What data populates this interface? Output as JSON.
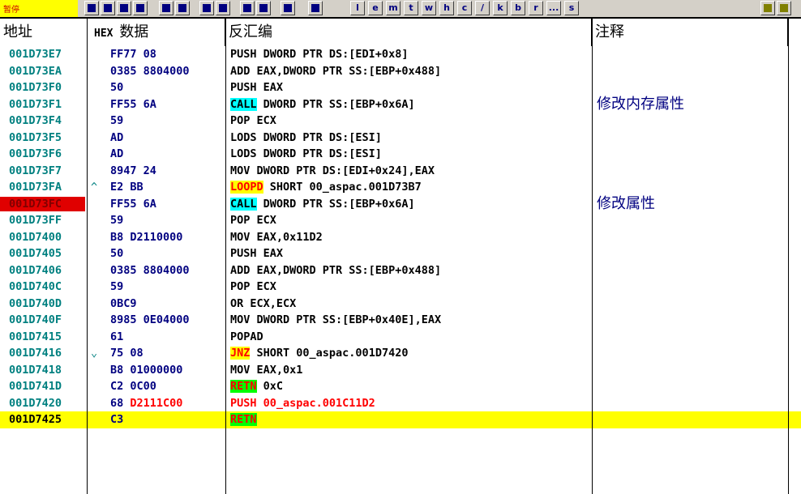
{
  "toolbar": {
    "status_text": "暂停",
    "buttons": [
      "l",
      "e",
      "m",
      "t",
      "w",
      "h",
      "c",
      "/",
      "k",
      "b",
      "r",
      "...",
      "s"
    ]
  },
  "columns": {
    "address": "地址",
    "hex_prefix": "HEX",
    "hex_cn": "数据",
    "disasm": "反汇编",
    "comment": "注释"
  },
  "rows": [
    {
      "addr": "001D73E7",
      "mark": "",
      "hex": "FF77 08",
      "asm": [
        {
          "t": "PUSH DWORD PTR DS:[EDI+0x8]"
        }
      ],
      "comment": ""
    },
    {
      "addr": "001D73EA",
      "mark": "",
      "hex": "0385 8804000",
      "asm": [
        {
          "t": "ADD EAX,DWORD PTR SS:[EBP+0x488]"
        }
      ],
      "comment": ""
    },
    {
      "addr": "001D73F0",
      "mark": "",
      "hex": "50",
      "asm": [
        {
          "t": "PUSH EAX"
        }
      ],
      "comment": ""
    },
    {
      "addr": "001D73F1",
      "mark": "",
      "hex": "FF55 6A",
      "asm": [
        {
          "t": "CALL",
          "cls": "hl-call"
        },
        {
          "t": " DWORD PTR SS:[EBP+0x6A]"
        }
      ],
      "comment": "修改内存属性"
    },
    {
      "addr": "001D73F4",
      "mark": "",
      "hex": "59",
      "asm": [
        {
          "t": "POP ECX"
        }
      ],
      "comment": ""
    },
    {
      "addr": "001D73F5",
      "mark": "",
      "hex": "AD",
      "asm": [
        {
          "t": "LODS DWORD PTR DS:[ESI]"
        }
      ],
      "comment": ""
    },
    {
      "addr": "001D73F6",
      "mark": "",
      "hex": "AD",
      "asm": [
        {
          "t": "LODS DWORD PTR DS:[ESI]"
        }
      ],
      "comment": ""
    },
    {
      "addr": "001D73F7",
      "mark": "",
      "hex": "8947 24",
      "asm": [
        {
          "t": "MOV DWORD PTR DS:[EDI+0x24],EAX"
        }
      ],
      "comment": ""
    },
    {
      "addr": "001D73FA",
      "mark": "^",
      "hex": "E2 BB",
      "asm": [
        {
          "t": "LOOPD",
          "cls": "hl-jmp"
        },
        {
          "t": " SHORT 00_aspac.001D73B7"
        }
      ],
      "comment": ""
    },
    {
      "addr": "001D73FC",
      "mark": "",
      "hex": "FF55 6A",
      "asm": [
        {
          "t": "CALL",
          "cls": "hl-call"
        },
        {
          "t": " DWORD PTR SS:[EBP+0x6A]"
        }
      ],
      "comment": "修改属性",
      "bp": true
    },
    {
      "addr": "001D73FF",
      "mark": "",
      "hex": "59",
      "asm": [
        {
          "t": "POP ECX"
        }
      ],
      "comment": ""
    },
    {
      "addr": "001D7400",
      "mark": "",
      "hex": "B8 D2110000",
      "asm": [
        {
          "t": "MOV EAX,0x11D2"
        }
      ],
      "comment": ""
    },
    {
      "addr": "001D7405",
      "mark": "",
      "hex": "50",
      "asm": [
        {
          "t": "PUSH EAX"
        }
      ],
      "comment": ""
    },
    {
      "addr": "001D7406",
      "mark": "",
      "hex": "0385 8804000",
      "asm": [
        {
          "t": "ADD EAX,DWORD PTR SS:[EBP+0x488]"
        }
      ],
      "comment": ""
    },
    {
      "addr": "001D740C",
      "mark": "",
      "hex": "59",
      "asm": [
        {
          "t": "POP ECX"
        }
      ],
      "comment": ""
    },
    {
      "addr": "001D740D",
      "mark": "",
      "hex": "0BC9",
      "asm": [
        {
          "t": "OR ECX,ECX"
        }
      ],
      "comment": ""
    },
    {
      "addr": "001D740F",
      "mark": "",
      "hex": "8985 0E04000",
      "asm": [
        {
          "t": "MOV DWORD PTR SS:[EBP+0x40E],EAX"
        }
      ],
      "comment": ""
    },
    {
      "addr": "001D7415",
      "mark": "",
      "hex": "61",
      "asm": [
        {
          "t": "POPAD"
        }
      ],
      "comment": ""
    },
    {
      "addr": "001D7416",
      "mark": "⌄",
      "hex": "75 08",
      "asm": [
        {
          "t": "JNZ",
          "cls": "hl-jmp"
        },
        {
          "t": " SHORT 00_aspac.001D7420"
        }
      ],
      "comment": ""
    },
    {
      "addr": "001D7418",
      "mark": "",
      "hex": "B8 01000000",
      "asm": [
        {
          "t": "MOV EAX,0x1"
        }
      ],
      "comment": ""
    },
    {
      "addr": "001D741D",
      "mark": "",
      "hex": "C2 0C00",
      "asm": [
        {
          "t": "RETN",
          "cls": "hl-ret"
        },
        {
          "t": " 0xC"
        }
      ],
      "comment": ""
    },
    {
      "addr": "001D7420",
      "mark": "",
      "hex": "68 D2111C00",
      "hexred": "D2111C00",
      "asm": [
        {
          "t": "PUSH 00_aspac.001C11D2",
          "cls": "red"
        }
      ],
      "comment": ""
    },
    {
      "addr": "001D7425",
      "mark": "",
      "hex": "C3",
      "asm": [
        {
          "t": "RETN",
          "cls": "hl-ret"
        }
      ],
      "comment": "",
      "current": true
    }
  ]
}
